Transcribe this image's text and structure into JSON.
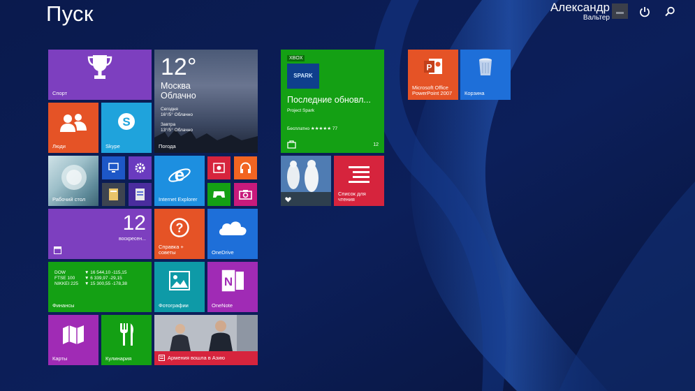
{
  "screen": {
    "title": "Пуск",
    "user_name": "Александр",
    "user_surname": "Вальтер"
  },
  "colors": {
    "background": "#0b1a4a",
    "purple": "#7d3fbf",
    "orange": "#e55326",
    "cyan": "#1fa3dc",
    "blue": "#1e6fd9",
    "green": "#14a014",
    "red": "#d6243d",
    "magenta": "#a02bb5",
    "teal": "#0e9aa7",
    "dark_blue": "#1d57c7"
  },
  "tiles": {
    "sport": {
      "label": "Спорт",
      "icon": "trophy-icon"
    },
    "weather": {
      "label": "Погода",
      "temp": "12°",
      "city": "Москва",
      "condition": "Облачно",
      "today_label": "Сегодня",
      "today_value": "16°/5° Облачно",
      "tomorrow_label": "Завтра",
      "tomorrow_value": "13°/5° Облачно"
    },
    "people": {
      "label": "Люди",
      "icon": "people-icon"
    },
    "skype": {
      "label": "Skype",
      "icon": "skype-icon"
    },
    "desktop": {
      "label": "Рабочий стол"
    },
    "ie": {
      "label": "Internet Explorer",
      "icon": "ie-icon"
    },
    "calendar": {
      "label": "",
      "day": "12",
      "weekday": "воскресен..."
    },
    "help": {
      "label": "Справка + советы",
      "icon": "help-icon"
    },
    "onedrive": {
      "label": "OneDrive",
      "icon": "cloud-icon"
    },
    "finance": {
      "label": "Финансы",
      "rows": [
        {
          "name": "DOW",
          "value": "▼ 16 544,10 -115,15"
        },
        {
          "name": "FTSE 100",
          "value": "▼ 6 339,97 -29,15"
        },
        {
          "name": "NIKKEI 225",
          "value": "▼ 15 300,55 -178,38"
        }
      ]
    },
    "photos": {
      "label": "Фотографии",
      "icon": "photos-icon"
    },
    "onenote": {
      "label": "OneNote",
      "icon": "onenote-icon"
    },
    "maps": {
      "label": "Карты",
      "icon": "map-icon"
    },
    "food": {
      "label": "Кулинария",
      "icon": "fork-knife-icon"
    },
    "news": {
      "label": "Армения вошла в Азию"
    },
    "store": {
      "badge": "XBOX",
      "logo": "SPARK",
      "title": "Последние обновл...",
      "subtitle": "Project Spark",
      "rating": "Бесплатно ★★★★★ 77",
      "count": "12"
    },
    "health": {
      "label": ""
    },
    "reading_list": {
      "label": "Список для чтения",
      "icon": "reading-list-icon"
    },
    "powerpoint": {
      "label": "Microsoft Office PowerPoint 2007",
      "icon": "powerpoint-icon"
    },
    "recycle_bin": {
      "label": "Корзина",
      "icon": "recycle-bin-icon"
    }
  }
}
